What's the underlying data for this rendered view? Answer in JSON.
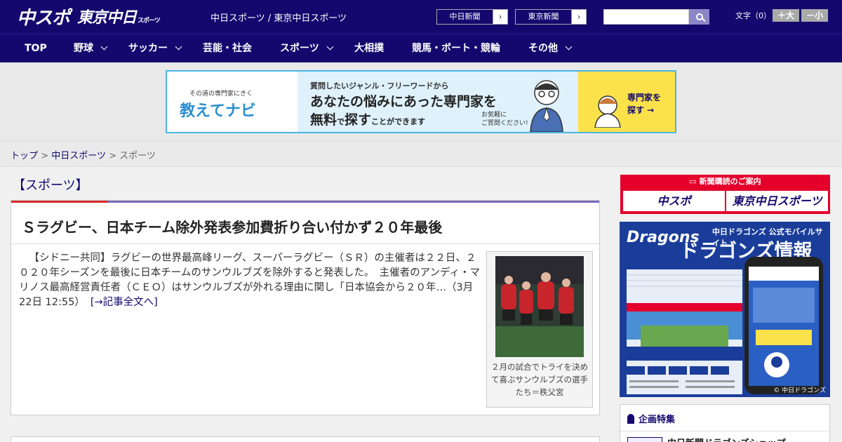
{
  "header": {
    "logo_chuspo": "中スポ",
    "logo_tokyo": "東京中日",
    "logo_tokyo_sub": "スポーツ",
    "site_title": "中日スポーツ / 東京中日スポーツ",
    "link_chunichi": "中日新聞",
    "link_tokyo": "東京新聞",
    "font_label": "文字（0）",
    "font_big": "＋大",
    "font_small": "－小"
  },
  "nav": [
    {
      "label": "TOP",
      "has_menu": false
    },
    {
      "label": "野球",
      "has_menu": true
    },
    {
      "label": "サッカー",
      "has_menu": true
    },
    {
      "label": "芸能・社会",
      "has_menu": false
    },
    {
      "label": "スポーツ",
      "has_menu": true
    },
    {
      "label": "大相撲",
      "has_menu": false
    },
    {
      "label": "競馬・ボート・競輪",
      "has_menu": false
    },
    {
      "label": "その他",
      "has_menu": true
    }
  ],
  "banner": {
    "small": "その道の専門家にきく",
    "brand": "教えてナビ",
    "line1": "質問したいジャンル・フリーワードから",
    "line2": "あなたの悩みにあった専門家を",
    "line3_a": "無料",
    "line3_b": "で",
    "line3_c": "探す",
    "line3_d": "ことができます",
    "line4": "お気軽に\nご質問ください!",
    "cta": "専門家を\n探す →",
    "accent_color": "#4ab6e6"
  },
  "breadcrumb": {
    "home": "トップ",
    "parent": "中日スポーツ",
    "current": "スポーツ",
    "sep": ">"
  },
  "section": {
    "title": "【スポーツ】"
  },
  "article": {
    "headline": "Ｓラグビー、日本チーム除外発表参加費折り合い付かず２０年最後",
    "body": "【シドニー共同】ラグビーの世界最高峰リーグ、スーパーラグビー（ＳＲ）の主催者は２２日、２０２０年シーズンを最後に日本チームのサンウルブズを除外すると発表した。　主催者のアンディ・マリノス最高経営責任者（ＣＥＯ）はサンウルブズが外れる理由に関し「日本協会から２０年…（3月22日 12:55）",
    "more": "[→記事全文へ]",
    "caption": "２月の試合でトライを決めて喜ぶサンウルブズの選手たち＝秩父宮"
  },
  "sidebar": {
    "subscribe_head": "新聞購読のご案内",
    "subscribe_chuspo": "中スポ",
    "subscribe_tokyo": "東京中日スポーツ",
    "dragons_logo": "Dragons",
    "dragons_t1": "中日ドラゴンズ 公式モバイルサイト",
    "dragons_t2": "ドラゴンズ情報",
    "dragons_copy": "© 中日ドラゴンズ",
    "feature_head": "企画特集",
    "feature_item": "中日新聞ドラゴンズショップ"
  },
  "colors": {
    "brand_navy": "#14086e",
    "subscribe_red": "#e4002b",
    "dragons_blue": "#1a3d9a"
  }
}
